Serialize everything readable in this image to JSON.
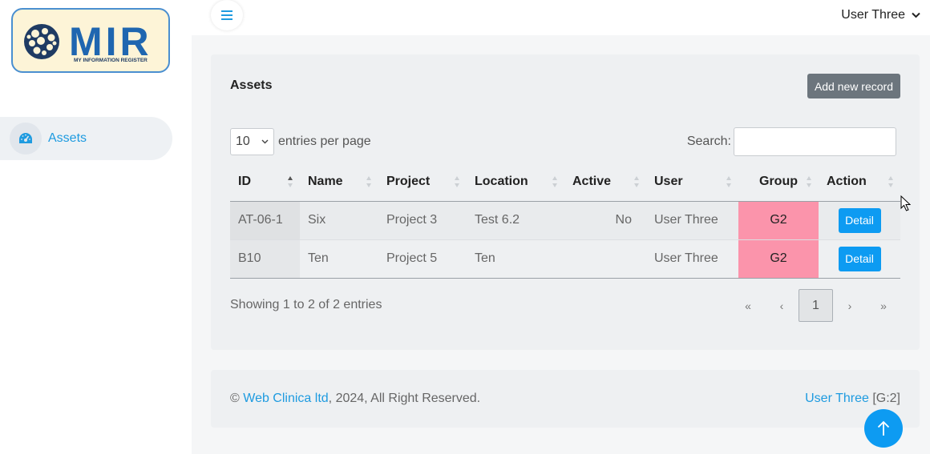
{
  "brand": {
    "logo_text": "MIR",
    "logo_tagline": "MY INFORMATION REGISTER"
  },
  "sidebar": {
    "items": [
      {
        "label": "Assets",
        "icon": "dashboard-gauge-icon"
      }
    ]
  },
  "topbar": {
    "menu_icon": "hamburger-icon",
    "user_name": "User Three"
  },
  "card": {
    "title": "Assets",
    "add_label": "Add new record",
    "per_page_value": "10",
    "per_page_label": "entries per page",
    "search_label": "Search:",
    "search_value": ""
  },
  "table": {
    "columns": [
      "ID",
      "Name",
      "Project",
      "Location",
      "Active",
      "User",
      "Group",
      "Action"
    ],
    "rows": [
      {
        "id": "AT-06-1",
        "name": "Six",
        "project": "Project 3",
        "location": "Test 6.2",
        "active": "No",
        "user": "User Three",
        "group": "G2",
        "action": "Detail"
      },
      {
        "id": "B10",
        "name": "Ten",
        "project": "Project 5",
        "location": "Ten",
        "active": "",
        "user": "User Three",
        "group": "G2",
        "action": "Detail"
      }
    ]
  },
  "pagination": {
    "info": "Showing 1 to 2 of 2 entries",
    "first": "«",
    "prev": "‹",
    "current": "1",
    "next": "›",
    "last": "»"
  },
  "footer": {
    "copyright_symbol": "©",
    "company": "Web Clinica ltd",
    "rest": ", 2024, All Right Reserved.",
    "user_link": "User Three",
    "group_tag": "[G:2]"
  },
  "colors": {
    "accent": "#1e9be0",
    "button_blue": "#0d9bf2",
    "group_pink": "#fb94ab",
    "add_button_gray": "#6c757d"
  }
}
